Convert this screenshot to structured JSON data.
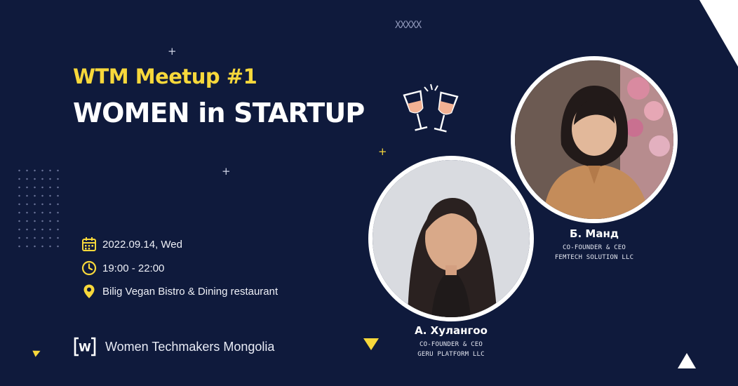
{
  "decor": {
    "top_marks": "XXXXX"
  },
  "event": {
    "subtitle": "WTM Meetup #1",
    "title": "WOMEN in STARTUP"
  },
  "details": {
    "date": "2022.09.14, Wed",
    "time": "19:00 - 22:00",
    "location": "Bilig Vegan Bistro & Dining restaurant"
  },
  "brand": {
    "logo_letter": "W",
    "name": "Women Techmakers Mongolia"
  },
  "speakers": [
    {
      "name": "А. Хулангоо",
      "role": "CO-FOUNDER & CEO",
      "company": "GERU PLATFORM LLC"
    },
    {
      "name": "Б. Манд",
      "role": "CO-FOUNDER & CEO",
      "company": "FEMTECH SOLUTION LLC"
    }
  ],
  "colors": {
    "background": "#0f1a3c",
    "accent_yellow": "#f7d83b",
    "text_white": "#ffffff"
  },
  "icons": {
    "date": "calendar-icon",
    "time": "clock-icon",
    "location": "location-pin-icon",
    "decoration": "wine-glasses-icon"
  }
}
